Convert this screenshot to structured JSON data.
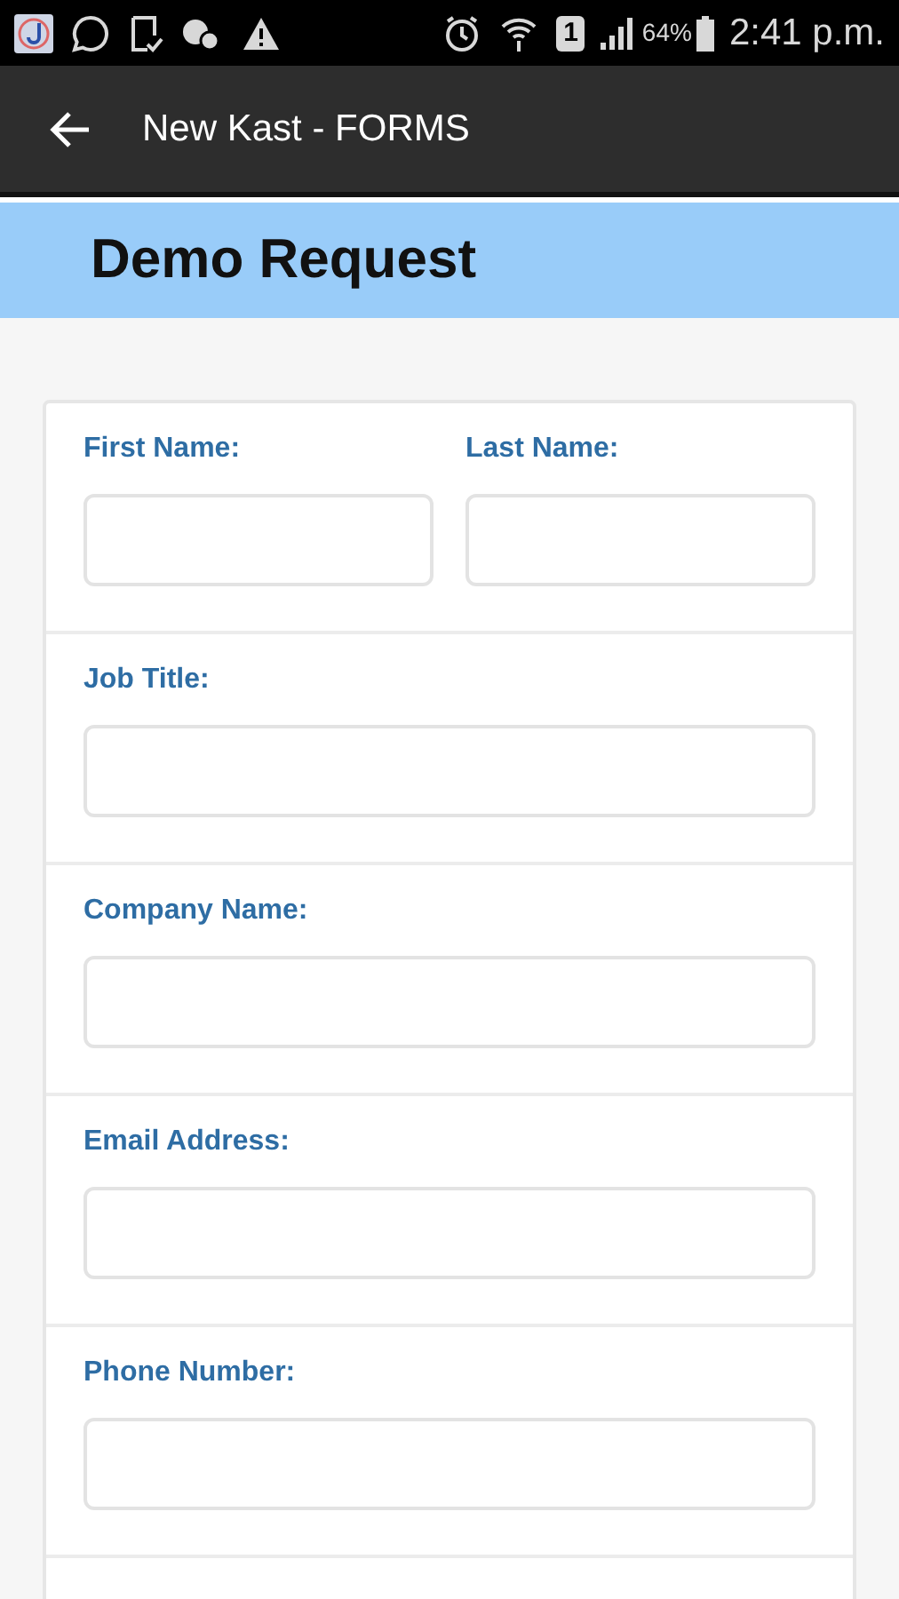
{
  "status_bar": {
    "sim_slot": "1",
    "battery": "64%",
    "time": "2:41 p.m."
  },
  "app_bar": {
    "title": "New Kast - FORMS"
  },
  "header": {
    "title": "Demo Request"
  },
  "form": {
    "rows": [
      {
        "fields": [
          {
            "label": "First Name:"
          },
          {
            "label": "Last Name:"
          }
        ]
      },
      {
        "fields": [
          {
            "label": "Job Title:"
          }
        ]
      },
      {
        "fields": [
          {
            "label": "Company Name:"
          }
        ]
      },
      {
        "fields": [
          {
            "label": "Email Address:"
          }
        ]
      },
      {
        "fields": [
          {
            "label": "Phone Number:"
          }
        ]
      }
    ]
  }
}
